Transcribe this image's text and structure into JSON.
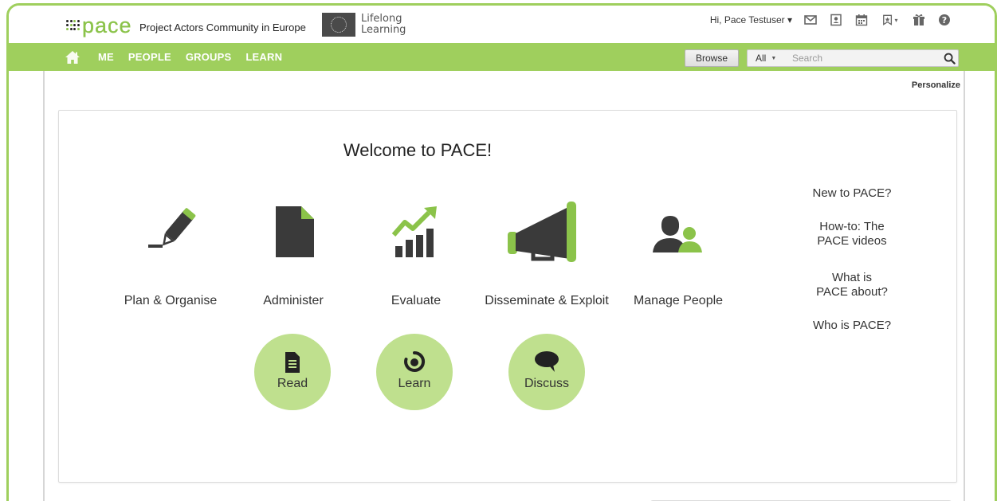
{
  "header": {
    "logo_text": "pace",
    "tagline": "Project Actors Community in Europe",
    "lifelong_line1": "Lifelong",
    "lifelong_line2": "Learning",
    "greeting": "Hi, Pace Testuser",
    "icons": [
      "mail-icon",
      "contacts-icon",
      "calendar-icon",
      "bookmarks-icon",
      "gift-icon",
      "help-icon"
    ]
  },
  "nav": {
    "items": [
      "ME",
      "PEOPLE",
      "GROUPS",
      "LEARN"
    ],
    "browse_label": "Browse",
    "search_scope": "All",
    "search_placeholder": "Search"
  },
  "page": {
    "personalize_label": "Personalize",
    "welcome_title": "Welcome to PACE!",
    "actions": [
      {
        "label": "Plan & Organise",
        "icon": "pen-icon"
      },
      {
        "label": "Administer",
        "icon": "document-icon"
      },
      {
        "label": "Evaluate",
        "icon": "growth-chart-icon"
      },
      {
        "label": "Disseminate & Exploit",
        "icon": "megaphone-icon"
      },
      {
        "label": "Manage People",
        "icon": "people-icon"
      }
    ],
    "side_links": {
      "new": "New to PACE?",
      "howto_1": "How-to: The",
      "howto_2": "PACE videos",
      "what_1": "What is",
      "what_2": "PACE about?",
      "who": "Who is PACE?"
    },
    "bubbles": [
      {
        "label": "Read",
        "icon": "read-icon"
      },
      {
        "label": "Learn",
        "icon": "learn-spiral-icon"
      },
      {
        "label": "Discuss",
        "icon": "discuss-icon"
      }
    ]
  },
  "colors": {
    "brand_green": "#9fcf5d",
    "bubble_green": "#bfe08e",
    "accent_green": "#8bc34a",
    "icon_dark": "#3a3a3a"
  }
}
